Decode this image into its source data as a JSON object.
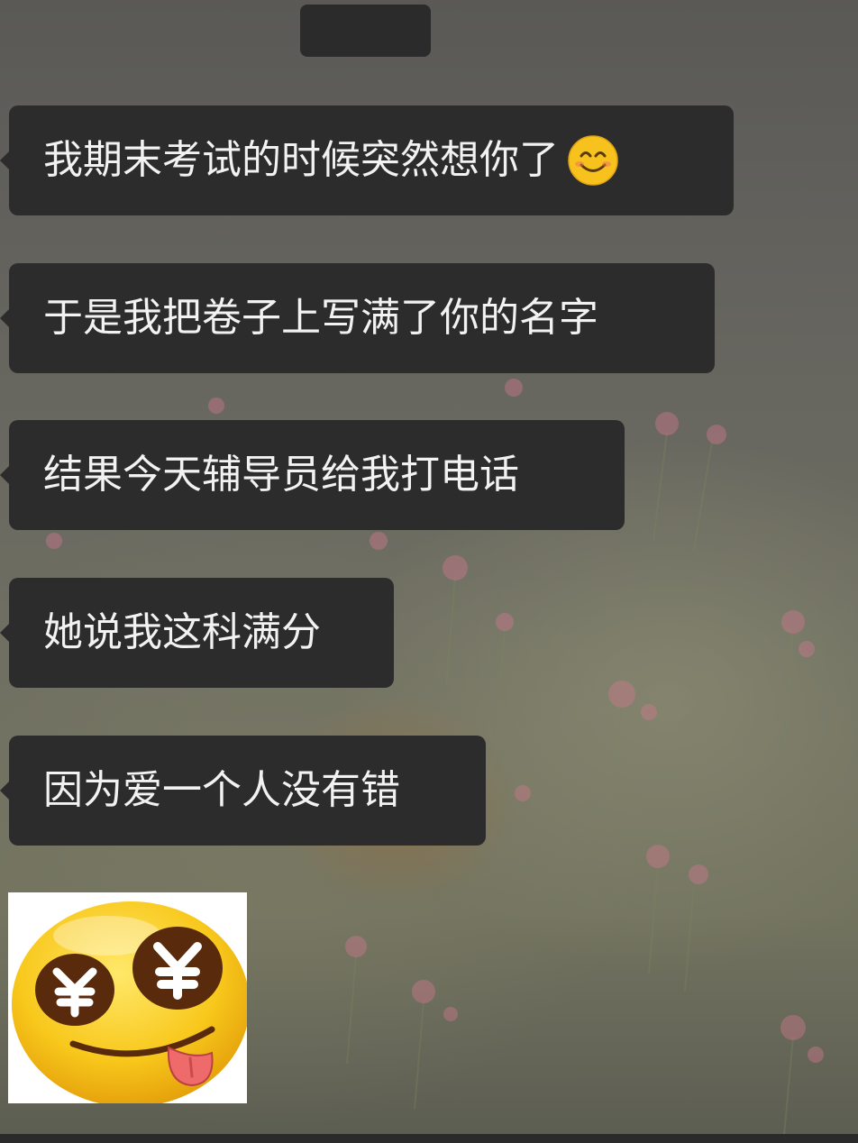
{
  "chat": {
    "time_label": "",
    "messages": [
      {
        "text": "我期末考试的时候突然想你了",
        "emoji": "smiling-face-emoji"
      },
      {
        "text": "于是我把卷子上写满了你的名字"
      },
      {
        "text": "结果今天辅导员给我打电话"
      },
      {
        "text": "她说我这科满分"
      },
      {
        "text": "因为爱一个人没有错"
      }
    ],
    "sticker": {
      "icon": "money-eyes-tongue-emoji"
    }
  },
  "colors": {
    "bubble": "#2c2c2c",
    "bubble_text": "#f2f2f2",
    "emoji_yellow": "#f7c21e",
    "time_pill": "#2b2b2b"
  }
}
